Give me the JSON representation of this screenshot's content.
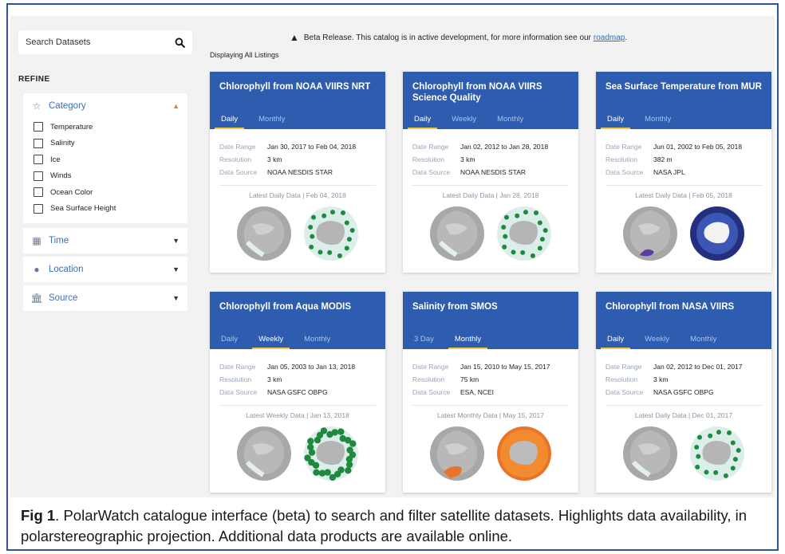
{
  "sidebar": {
    "search_placeholder": "Search Datasets",
    "refine_label": "REFINE",
    "category": {
      "label": "Category",
      "options": [
        "Temperature",
        "Salinity",
        "Ice",
        "Winds",
        "Ocean Color",
        "Sea Surface Height"
      ]
    },
    "time_label": "Time",
    "location_label": "Location",
    "source_label": "Source"
  },
  "beta_notice": {
    "text": "Beta Release. This catalog is in active development, for more information see our",
    "link": "roadmap",
    "end": "."
  },
  "displaying": "Displaying All Listings",
  "meta_labels": {
    "range": "Date Range",
    "resolution": "Resolution",
    "source": "Data Source"
  },
  "cards": [
    {
      "title": "Chlorophyll from NOAA VIIRS NRT",
      "tabs": [
        "Daily",
        "Monthly"
      ],
      "active_tab": 0,
      "date_range": "Jan 30, 2017 to Feb 04, 2018",
      "resolution": "3 km",
      "data_source": "NOAA NESDIS STAR",
      "latest": "Latest Daily Data | Feb 04, 2018",
      "style": "chl-sparse"
    },
    {
      "title": "Chlorophyll from NOAA VIIRS Science Quality",
      "tabs": [
        "Daily",
        "Weekly",
        "Monthly"
      ],
      "active_tab": 0,
      "date_range": "Jan 02, 2012 to Jan 28, 2018",
      "resolution": "3 km",
      "data_source": "NOAA NESDIS STAR",
      "latest": "Latest Daily Data | Jan 28, 2018",
      "style": "chl-sparse"
    },
    {
      "title": "Sea Surface Temperature from MUR",
      "tabs": [
        "Daily",
        "Monthly"
      ],
      "active_tab": 0,
      "date_range": "Jun 01, 2002 to Feb 05, 2018",
      "resolution": "382 m",
      "data_source": "NASA JPL",
      "latest": "Latest Daily Data | Feb 05, 2018",
      "style": "sst"
    },
    {
      "title": "Chlorophyll from Aqua MODIS",
      "tabs": [
        "Daily",
        "Weekly",
        "Monthly"
      ],
      "active_tab": 1,
      "date_range": "Jan 05, 2003 to Jan 13, 2018",
      "resolution": "3 km",
      "data_source": "NASA GSFC OBPG",
      "latest": "Latest Weekly Data | Jan 13, 2018",
      "style": "chl-dense"
    },
    {
      "title": "Salinity from SMOS",
      "tabs": [
        "3 Day",
        "Monthly"
      ],
      "active_tab": 1,
      "date_range": "Jan 15, 2010 to May 15, 2017",
      "resolution": "75 km",
      "data_source": "ESA, NCEI",
      "latest": "Latest Monthly Data | May 15, 2017",
      "style": "salinity"
    },
    {
      "title": "Chlorophyll from NASA VIIRS",
      "tabs": [
        "Daily",
        "Weekly",
        "Monthly"
      ],
      "active_tab": 0,
      "date_range": "Jan 02, 2012 to Dec 01, 2017",
      "resolution": "3 km",
      "data_source": "NASA GSFC OBPG",
      "latest": "Latest Daily Data | Dec 01, 2017",
      "style": "chl-sparse"
    }
  ],
  "caption": {
    "bold": "Fig 1",
    "text": ". PolarWatch catalogue interface (beta) to search and filter satellite datasets. Highlights data availability, in polarstereographic projection. Additional data products are available online."
  },
  "colors": {
    "card_header": "#2e5cae",
    "tab_underline": "#f4c542",
    "link": "#2a6fc2",
    "caret_open": "#e67e22",
    "frame": "#2f5597"
  }
}
